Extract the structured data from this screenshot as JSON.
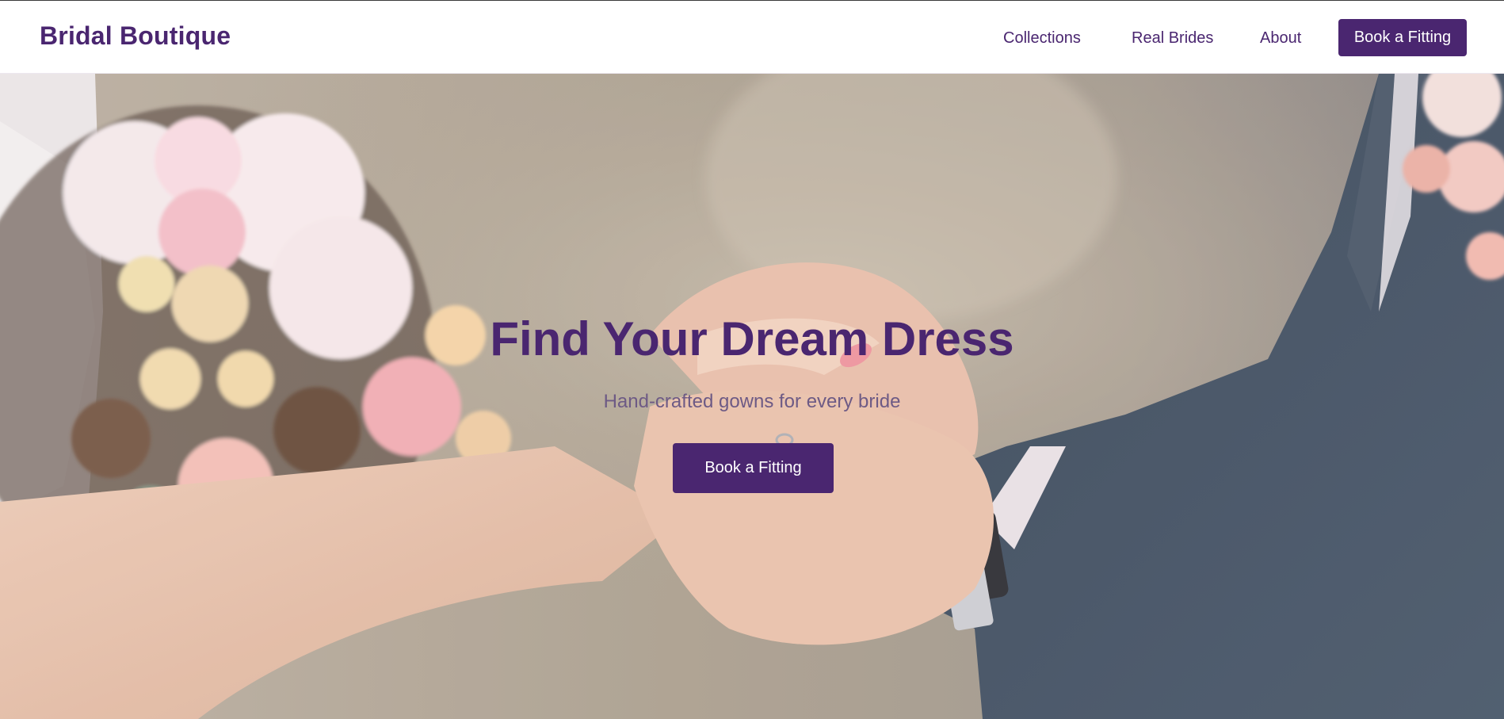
{
  "brand": {
    "name": "Bridal Boutique"
  },
  "nav": {
    "links": [
      "Collections",
      "Real Brides",
      "About"
    ],
    "cta_label": "Book a Fitting"
  },
  "hero": {
    "title": "Find Your Dream Dress",
    "subtitle": "Hand-crafted gowns for every bride",
    "cta_label": "Book a Fitting",
    "image": "wedding-ring-exchange-photo"
  },
  "colors": {
    "accent": "#4a2670",
    "subtitle": "#6d5a85",
    "header_bg": "#ffffff"
  }
}
